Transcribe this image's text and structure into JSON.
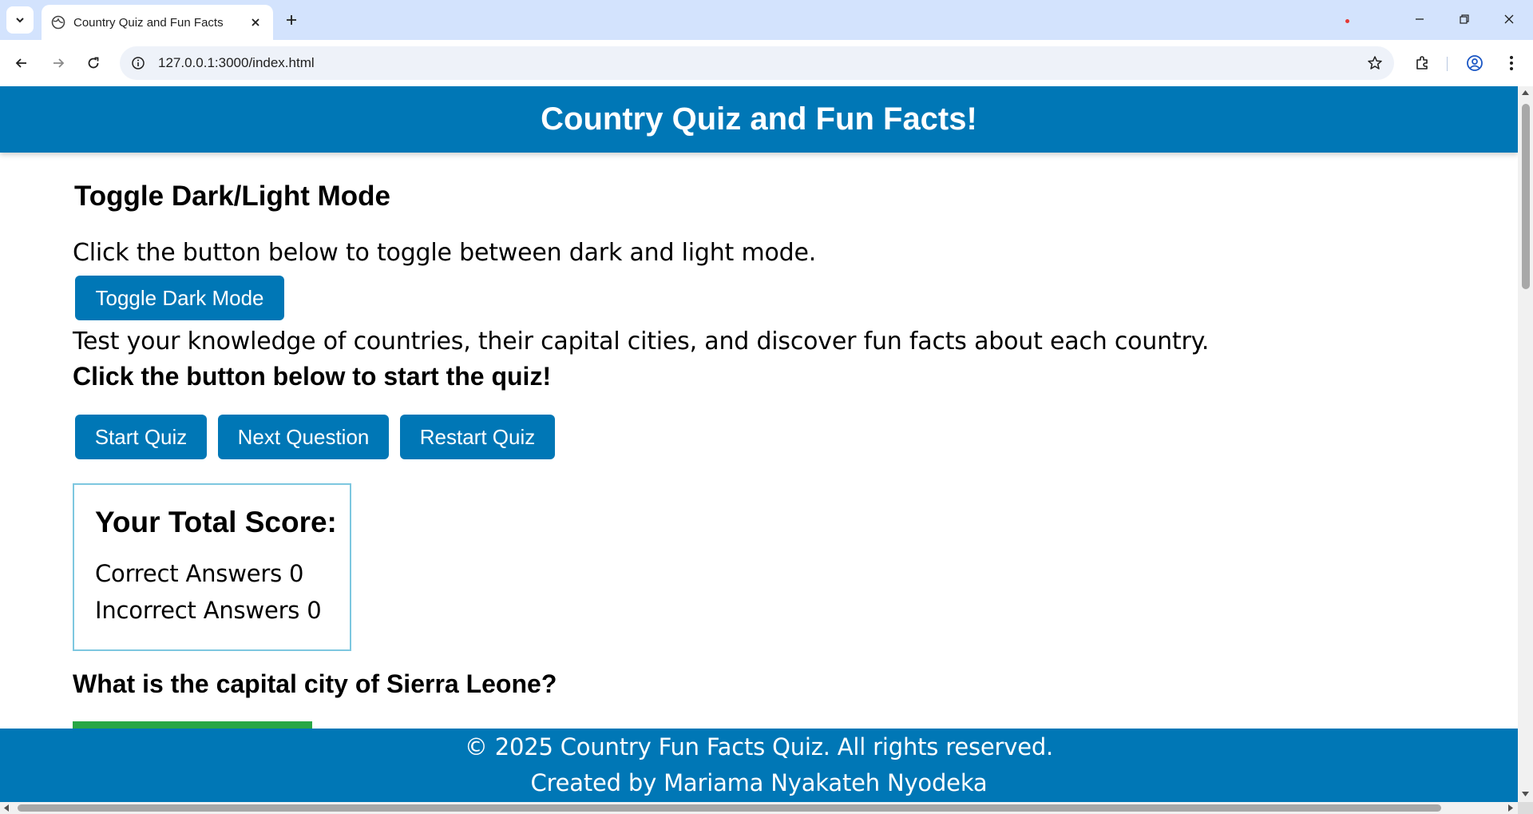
{
  "browser": {
    "tab_title": "Country Quiz and Fun Facts",
    "url": "127.0.0.1:3000/index.html",
    "icons": {
      "tab_menu": "chevron-down-icon",
      "favicon": "globe-icon",
      "tab_close": "close-icon",
      "new_tab": "plus-icon",
      "minimize": "minimize-icon",
      "restore": "restore-icon",
      "close_window": "close-icon",
      "back": "arrow-left-icon",
      "forward": "arrow-right-icon",
      "reload": "reload-icon",
      "site_info": "info-icon",
      "bookmark": "star-icon",
      "extensions": "puzzle-icon",
      "profile": "account-icon",
      "menu": "kebab-menu-icon"
    },
    "accent_color": "#d3e3fd"
  },
  "page": {
    "header_title": "Country Quiz and Fun Facts!",
    "toggle_heading": "Toggle Dark/Light Mode",
    "toggle_text": "Click the button below to toggle between dark and light mode.",
    "toggle_button": "Toggle Dark Mode",
    "intro_text": "Test your knowledge of countries, their capital cities, and discover fun facts about each country.",
    "cta_text": "Click the button below to start the quiz!",
    "buttons": {
      "start": "Start Quiz",
      "next": "Next Question",
      "restart": "Restart Quiz"
    },
    "score": {
      "title": "Your Total Score:",
      "correct_label": "Correct Answers",
      "correct_value": "0",
      "incorrect_label": "Incorrect Answers",
      "incorrect_value": "0"
    },
    "question": "What is the capital city of Sierra Leone?",
    "footer_line1": "© 2025 Country Fun Facts Quiz. All rights reserved.",
    "footer_line2": "Created by Mariama Nyakateh Nyodeka",
    "colors": {
      "primary": "#0077b6",
      "score_border": "#7dc7e0",
      "answer_green": "#28a745"
    }
  }
}
